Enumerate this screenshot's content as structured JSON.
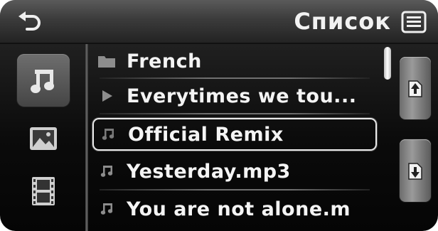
{
  "header": {
    "title": "Список",
    "back_icon": "back-arrow-icon",
    "list_view_icon": "list-view-icon"
  },
  "sidebar": {
    "tabs": [
      {
        "name": "music",
        "icon": "music-note-icon",
        "active": true
      },
      {
        "name": "pictures",
        "icon": "picture-icon",
        "active": false
      },
      {
        "name": "video",
        "icon": "film-icon",
        "active": false
      }
    ]
  },
  "list": {
    "items": [
      {
        "label": "French",
        "icon": "folder-icon",
        "selected": false
      },
      {
        "label": "Everytimes we tou...",
        "icon": "play-icon",
        "selected": false
      },
      {
        "label": "Official Remix",
        "icon": "music-note-icon",
        "selected": true
      },
      {
        "label": "Yesterday.mp3",
        "icon": "music-note-icon",
        "selected": false
      },
      {
        "label": "You are not alone.m",
        "icon": "music-note-icon",
        "selected": false
      }
    ]
  },
  "scroll": {
    "page_up_icon": "page-up-icon",
    "page_down_icon": "page-down-icon"
  },
  "colors": {
    "text": "#f4f4f4",
    "header_bg": "#3b3b3b",
    "background": "#0b0b0b"
  }
}
